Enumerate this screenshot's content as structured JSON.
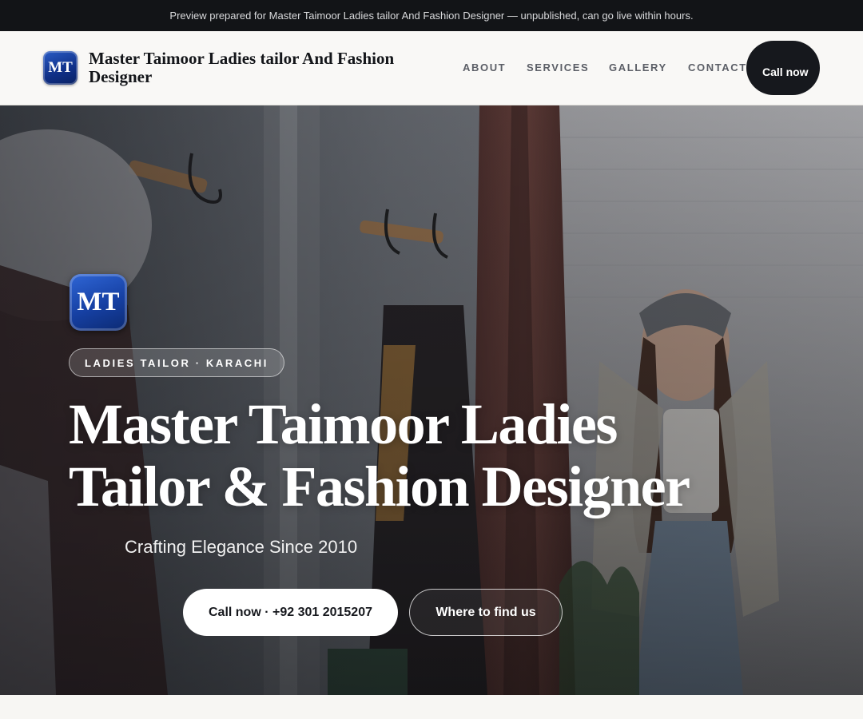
{
  "preview_banner": {
    "text": "Preview prepared for Master Taimoor Ladies tailor And Fashion Designer — unpublished, can go live within hours."
  },
  "header": {
    "logo_text": "MT",
    "business_name": "Master Taimoor Ladies tailor And Fashion Designer",
    "nav": [
      {
        "label": "ABOUT"
      },
      {
        "label": "SERVICES"
      },
      {
        "label": "GALLERY"
      },
      {
        "label": "CONTACT"
      }
    ],
    "call_button": "Call now"
  },
  "hero": {
    "logo_text": "MT",
    "badge": "LADIES TAILOR · KARACHI",
    "title": "Master Taimoor Ladies Tailor & Fashion Designer",
    "subtitle": "Crafting Elegance Since 2010",
    "primary_button": "Call now · +92 301 2015207",
    "secondary_button": "Where to find us"
  },
  "colors": {
    "banner_bg": "#121417",
    "nav_bg": "#f9f8f6",
    "dark_button": "#16181d",
    "logo_blue": "#1640a3"
  }
}
